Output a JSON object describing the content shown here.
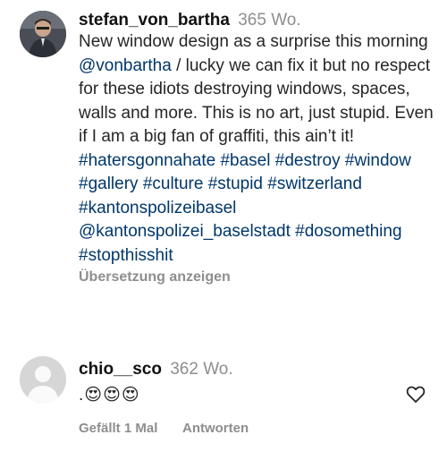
{
  "post": {
    "username": "stefan_von_bartha",
    "time": "365 Wo.",
    "caption_parts": [
      {
        "t": "text",
        "v": "New window design as a surprise this morning "
      },
      {
        "t": "mention",
        "v": "@vonbartha"
      },
      {
        "t": "text",
        "v": " / lucky we can fix it but no respect for these idiots destroying windows, spaces, walls and more. This is no art, just stupid. Even if I am a big fan of graffiti, this ain’t it! "
      },
      {
        "t": "hashtag",
        "v": "#hatersgonnahate"
      },
      {
        "t": "text",
        "v": " "
      },
      {
        "t": "hashtag",
        "v": "#basel"
      },
      {
        "t": "text",
        "v": " "
      },
      {
        "t": "hashtag",
        "v": "#destroy"
      },
      {
        "t": "text",
        "v": " "
      },
      {
        "t": "hashtag",
        "v": "#window"
      },
      {
        "t": "text",
        "v": " "
      },
      {
        "t": "hashtag",
        "v": "#gallery"
      },
      {
        "t": "text",
        "v": " "
      },
      {
        "t": "hashtag",
        "v": "#culture"
      },
      {
        "t": "text",
        "v": " "
      },
      {
        "t": "hashtag",
        "v": "#stupid"
      },
      {
        "t": "text",
        "v": " "
      },
      {
        "t": "hashtag",
        "v": "#switzerland"
      },
      {
        "t": "text",
        "v": " "
      },
      {
        "t": "hashtag",
        "v": "#kantonspolizeibasel"
      },
      {
        "t": "text",
        "v": " "
      },
      {
        "t": "mention",
        "v": "@kantonspolizei_baselstadt"
      },
      {
        "t": "text",
        "v": " "
      },
      {
        "t": "hashtag",
        "v": "#dosomething"
      },
      {
        "t": "text",
        "v": " "
      },
      {
        "t": "hashtag",
        "v": "#stopthisshit"
      }
    ],
    "translate_label": "Übersetzung anzeigen"
  },
  "comment": {
    "username": "chio__sco",
    "time": "362 Wo.",
    "text": ".😍😍😍",
    "likes_label": "Gefällt 1 Mal",
    "reply_label": "Antworten"
  },
  "icons": {
    "heart": "heart-outline-icon",
    "avatar_default": "default-avatar-icon"
  },
  "colors": {
    "link": "#00376b",
    "muted": "#8e8e8e",
    "text": "#262626"
  }
}
